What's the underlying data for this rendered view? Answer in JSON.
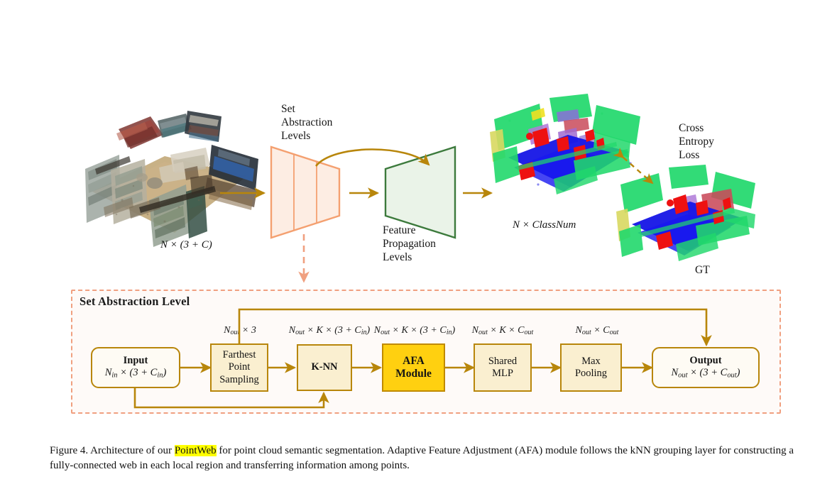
{
  "figure": {
    "caption_pre": "Figure 4. Architecture of our ",
    "caption_highlight": "PointWeb",
    "caption_post": " for point cloud semantic segmentation.  Adaptive Feature Adjustment (AFA) module follows the kNN grouping layer for constructing a fully-connected web in each local region and transferring information among points."
  },
  "top": {
    "input_cloud_label": "N × (3 + C)",
    "encoder_label": "Set\nAbstraction\nLevels",
    "decoder_label": "Feature\nPropagation\nLevels",
    "prediction_label": "N × ClassNum",
    "loss_label": "Cross\nEntropy\nLoss",
    "gt_label": "GT"
  },
  "sa_panel": {
    "title": "Set Abstraction Level",
    "blocks": [
      {
        "name": "input",
        "title": "Input",
        "shape": "N_in × (3 + C_in)",
        "style": "round"
      },
      {
        "name": "fps",
        "title": "Farthest\nPoint\nSampling",
        "shape": "",
        "style": "plain"
      },
      {
        "name": "knn",
        "title": "K-NN",
        "shape": "",
        "style": "plain"
      },
      {
        "name": "afa",
        "title": "AFA\nModule",
        "shape": "",
        "style": "highlight"
      },
      {
        "name": "mlp",
        "title": "Shared\nMLP",
        "shape": "",
        "style": "plain"
      },
      {
        "name": "maxpool",
        "title": "Max\nPooling",
        "shape": "",
        "style": "plain"
      },
      {
        "name": "output",
        "title": "Output",
        "shape": "N_out × (3 + C_out)",
        "style": "round"
      }
    ],
    "dims": [
      "N_out × 3",
      "N_out × K × (3 + C_in)",
      "N_out × K × (3 + C_in)",
      "N_out × K × C_out",
      "N_out × C_out"
    ]
  },
  "colors": {
    "arrow": "#B8860B",
    "encoder_stroke": "#F4A070",
    "encoder_fill": "#FDEDE3",
    "decoder_stroke": "#3C7A3C",
    "decoder_fill": "#EAF3E8",
    "panel_border": "#F0A080",
    "panel_fill": "#FEFAF8",
    "box_border": "#B8860B",
    "box_fill": "#FAEFD0",
    "highlight_fill": "#FFD010",
    "caption_highlight": "#FFFF00"
  }
}
